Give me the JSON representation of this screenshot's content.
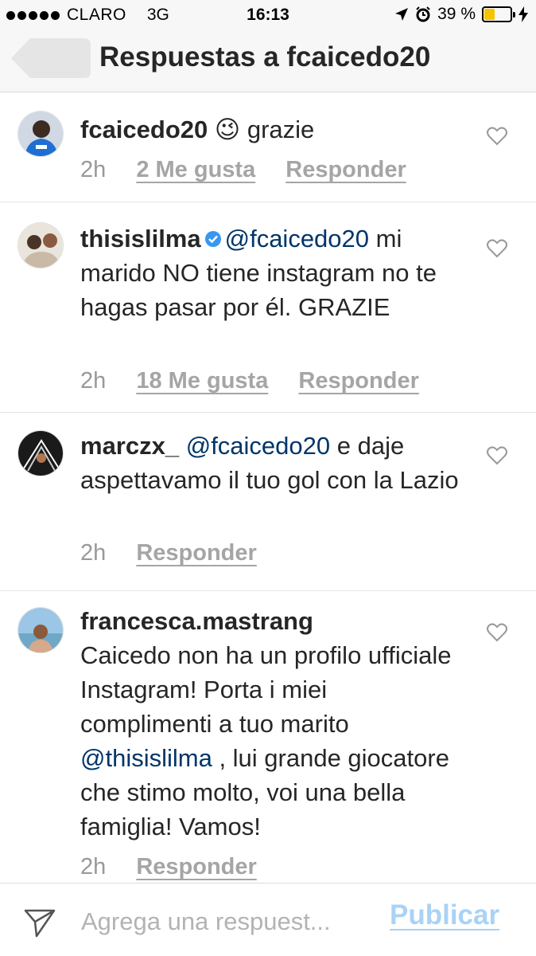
{
  "status_bar": {
    "carrier": "CLARO",
    "network": "3G",
    "time": "16:13",
    "battery": "39 %",
    "battery_level": 0.39
  },
  "header": {
    "title": "Respuestas a fcaicedo20",
    "back_icon": "back-arrow-icon"
  },
  "comments": [
    {
      "username": "fcaicedo20",
      "emoji": "😉",
      "text": "grazie",
      "time": "2h",
      "likes": "2 Me gusta",
      "reply": "Responder"
    },
    {
      "username": "thisislilma",
      "verified": true,
      "mention": "@fcaicedo20",
      "text": " mi marido NO tiene instagram no te hagas pasar por él. GRAZIE",
      "time": "2h",
      "likes": "18 Me gusta",
      "reply": "Responder"
    },
    {
      "username": "marczx_",
      "mention": "@fcaicedo20",
      "text": " e daje aspettavamo il tuo gol con la Lazio",
      "time": "2h",
      "reply": "Responder"
    },
    {
      "username": "francesca.mastrang",
      "text_before": "Caicedo non ha un profilo ufficiale Instagram! Porta i miei complimenti a tuo marito ",
      "mention": "@thisislilma",
      "text_after": " , lui grande giocatore che stimo molto, voi una bella famiglia! Vamos!",
      "time": "2h",
      "reply": "Responder"
    }
  ],
  "footer": {
    "placeholder": "Agrega una respuest...",
    "publish_label": "Publicar"
  },
  "colors": {
    "mention": "#003569",
    "meta": "#999999",
    "publish": "#a9d2f6",
    "battery": "#f5c400"
  }
}
